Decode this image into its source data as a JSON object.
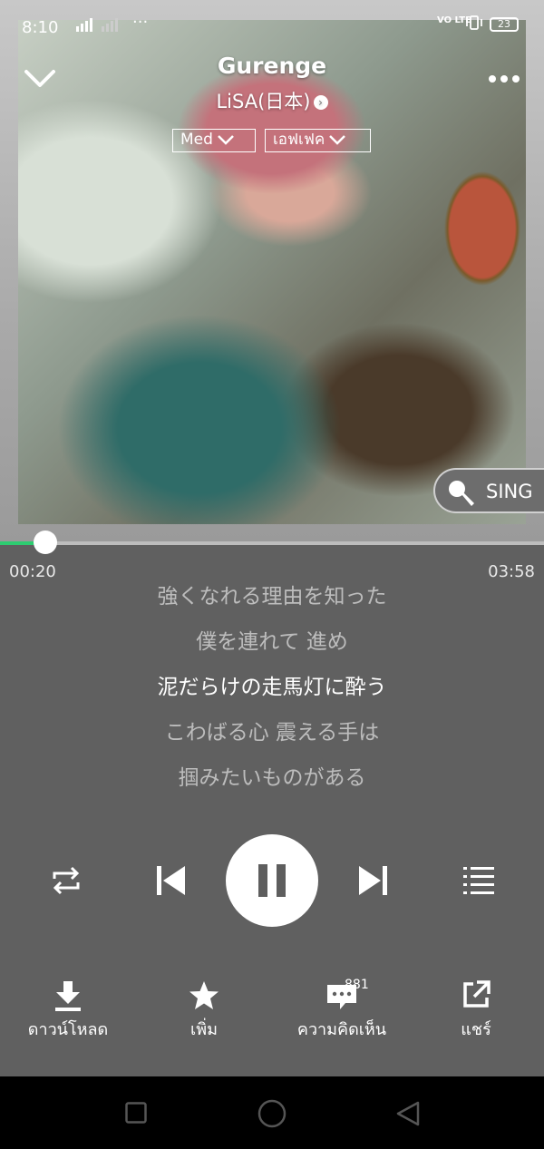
{
  "status_bar": {
    "time": "8:10",
    "signal": "4G",
    "dots": "···",
    "volte": "VO LTE",
    "battery": "23"
  },
  "player": {
    "title": "Gurenge",
    "artist": "LiSA(日本)",
    "quality": "Med",
    "effect": "เอฟเฟค",
    "sing_label": "SING",
    "current_time": "00:20",
    "total_time": "03:58",
    "progress": 0.084
  },
  "lyrics": [
    {
      "text": "強くなれる理由を知った",
      "active": false
    },
    {
      "text": "僕を連れて 進め",
      "active": false
    },
    {
      "text": "泥だらけの走馬灯に酔う",
      "active": true
    },
    {
      "text": "こわばる心 震える手は",
      "active": false
    },
    {
      "text": "掴みたいものがある",
      "active": false
    }
  ],
  "actions": {
    "download": "ดาวน์โหลด",
    "add": "เพิ่ม",
    "comments": "ความคิดเห็น",
    "comment_count": "881",
    "share": "แชร์"
  },
  "colors": {
    "accent": "#2ecc71",
    "background": "#606060"
  }
}
